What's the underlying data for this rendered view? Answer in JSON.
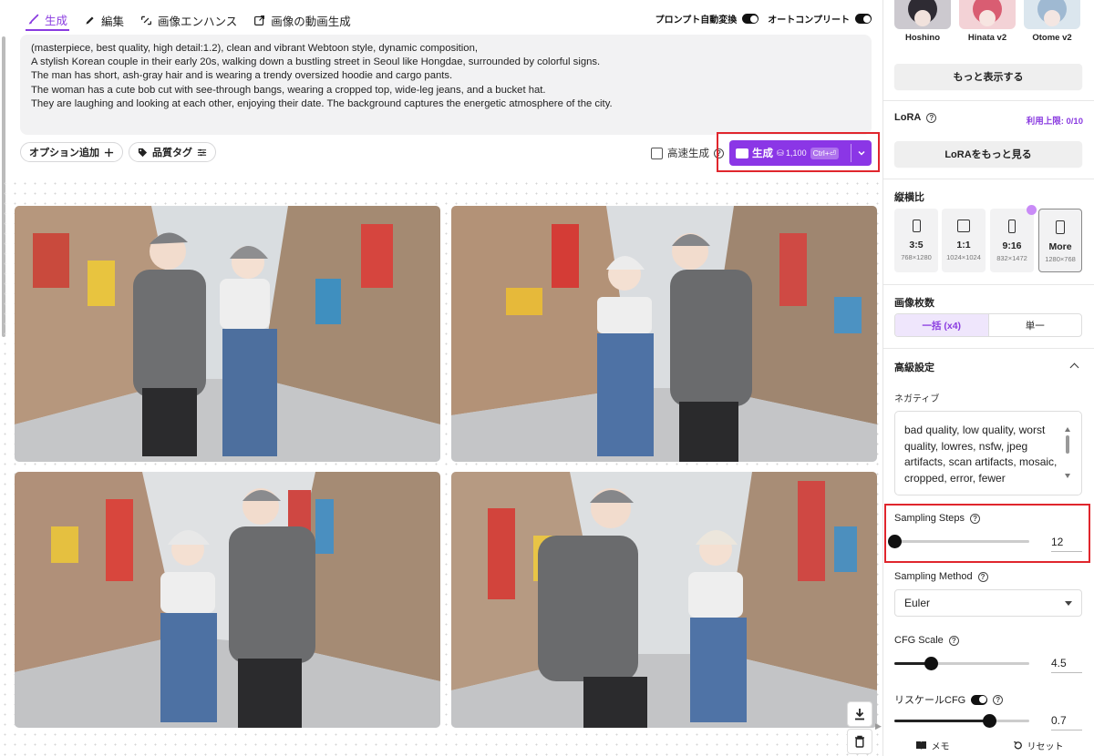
{
  "tabs": [
    {
      "label": "生成",
      "active": true,
      "icon": "brush-icon"
    },
    {
      "label": "編集",
      "active": false,
      "icon": "pencil-icon"
    },
    {
      "label": "画像エンハンス",
      "active": false,
      "icon": "enhance-icon"
    },
    {
      "label": "画像の動画生成",
      "active": false,
      "icon": "video-export-icon"
    }
  ],
  "toggles": {
    "auto_prompt": "プロンプト自動変換",
    "autocomplete": "オートコンプリート"
  },
  "prompt": {
    "lines": [
      "(masterpiece, best quality, high detail:1.2), clean and vibrant Webtoon style, dynamic composition,",
      "A stylish Korean couple in their early 20s, walking down a bustling street in Seoul like Hongdae, surrounded by colorful signs.",
      "The man has short, ash-gray hair and is wearing a trendy oversized hoodie and cargo pants.",
      "The woman has a cute bob cut with see-through bangs, wearing a cropped top, wide-leg jeans, and a bucket hat.",
      "They are laughing and looking at each other, enjoying their date. The background captures the energetic atmosphere of the city."
    ]
  },
  "chips": {
    "add_option": "オプション追加",
    "quality_tag": "品質タグ"
  },
  "fast_gen": {
    "label": "高速生成"
  },
  "generate": {
    "label": "生成",
    "cost": "1,100",
    "shortcut": "Ctrl+⏎",
    "color": "#8b36e6"
  },
  "models": [
    {
      "name": "Hoshino"
    },
    {
      "name": "Hinata v2"
    },
    {
      "name": "Otome v2"
    }
  ],
  "side": {
    "show_more": "もっと表示する",
    "lora_title": "LoRA",
    "lora_limit": "利用上限: 0/10",
    "lora_more": "LoRAをもっと見る",
    "aspect_title": "縦横比",
    "aspects": [
      {
        "name": "3:5",
        "size": "768×1280"
      },
      {
        "name": "1:1",
        "size": "1024×1024"
      },
      {
        "name": "9:16",
        "size": "832×1472"
      },
      {
        "name": "More",
        "size": "1280×768"
      }
    ],
    "count_title": "画像枚数",
    "count_options": [
      "一括 (x4)",
      "単一"
    ],
    "advanced_title": "高級設定",
    "negative_label": "ネガティブ",
    "negative_text": "bad quality, low quality, worst quality, lowres, nsfw, jpeg artifacts, scan artifacts, mosaic, cropped, error, fewer",
    "sampling_steps_label": "Sampling Steps",
    "sampling_steps_value": "12",
    "sampling_steps_fraction": 0.0,
    "sampling_method_label": "Sampling Method",
    "sampling_method_value": "Euler",
    "cfg_label": "CFG Scale",
    "cfg_value": "4.5",
    "cfg_fraction": 0.27,
    "rescale_label": "リスケールCFG",
    "rescale_value": "0.7",
    "rescale_fraction": 0.7,
    "memo": "メモ",
    "reset": "リセット"
  },
  "accent_color": "#8a3be0",
  "highlight_color": "#e0262d"
}
